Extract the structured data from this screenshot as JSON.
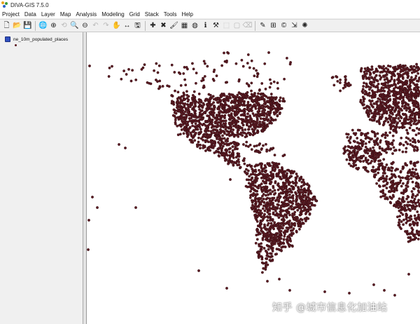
{
  "app": {
    "title": "DIVA-GIS 7.5.0",
    "logo_colors": [
      "#e8a21b",
      "#3a9a3a",
      "#2a62c9"
    ]
  },
  "menu": {
    "items": [
      "Project",
      "Data",
      "Layer",
      "Map",
      "Analysis",
      "Modeling",
      "Grid",
      "Stack",
      "Tools",
      "Help"
    ]
  },
  "toolbar": {
    "file_group": [
      {
        "icon": "new-file-icon",
        "glyph": "🗋"
      },
      {
        "icon": "open-folder-icon",
        "glyph": "📂"
      },
      {
        "icon": "save-icon",
        "glyph": "💾"
      }
    ],
    "nav_group": [
      {
        "icon": "globe-full-extent-icon",
        "glyph": "🌐"
      },
      {
        "icon": "zoom-in-icon",
        "glyph": "⊕"
      },
      {
        "icon": "zoom-previous-icon",
        "glyph": "⟲",
        "disabled": true
      },
      {
        "icon": "zoom-layer-icon",
        "glyph": "🔍"
      },
      {
        "icon": "zoom-out-icon",
        "glyph": "⊖"
      },
      {
        "icon": "undo-icon",
        "glyph": "↶",
        "disabled": true
      },
      {
        "icon": "redo-icon",
        "glyph": "↷",
        "disabled": true
      },
      {
        "icon": "pan-hand-icon",
        "glyph": "✋"
      },
      {
        "icon": "measure-icon",
        "glyph": "↔"
      },
      {
        "icon": "export-map-icon",
        "glyph": "🖫"
      }
    ],
    "tools_group": [
      {
        "icon": "add-layer-icon",
        "glyph": "✚"
      },
      {
        "icon": "remove-layer-icon",
        "glyph": "✖"
      },
      {
        "icon": "properties-icon",
        "glyph": "🖌"
      },
      {
        "icon": "attribute-table-icon",
        "glyph": "▦"
      },
      {
        "icon": "identify-globe-icon",
        "glyph": "◍"
      },
      {
        "icon": "info-icon",
        "glyph": "ℹ"
      },
      {
        "icon": "tools-icon",
        "glyph": "⚒"
      },
      {
        "icon": "select-icon",
        "glyph": "⬚",
        "disabled": true
      },
      {
        "icon": "select-rectangle-icon",
        "glyph": "▢",
        "disabled": true
      },
      {
        "icon": "clear-selection-icon",
        "glyph": "⌫",
        "disabled": true
      }
    ],
    "extra_group": [
      {
        "icon": "point-tool-icon",
        "glyph": "✎"
      },
      {
        "icon": "grid-icon",
        "glyph": "⊞"
      },
      {
        "icon": "color-icon",
        "glyph": "©"
      },
      {
        "icon": "scale-icon",
        "glyph": "⇲"
      },
      {
        "icon": "sun-icon",
        "glyph": "✺"
      }
    ]
  },
  "legend": {
    "layer_name": "ne_10m_populated_places",
    "symbol_color": "#5a1a20"
  },
  "map": {
    "point_fill": "#5b1a22",
    "point_stroke": "#2b0a0f"
  },
  "watermark": {
    "text": "知乎 @城市信息化加油站"
  }
}
